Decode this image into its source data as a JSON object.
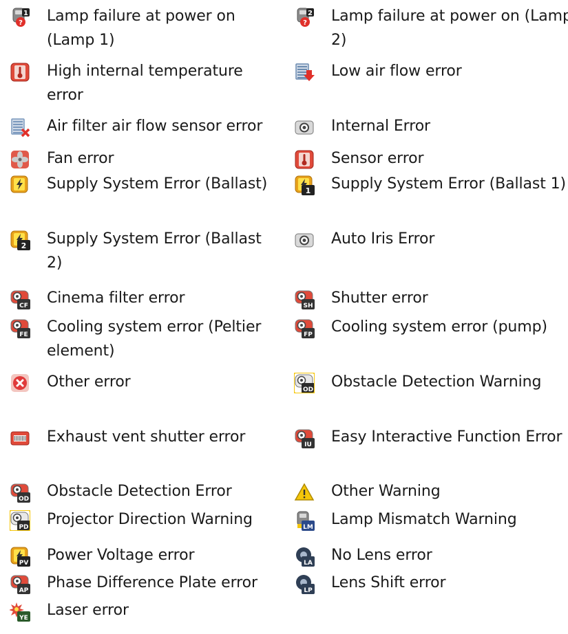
{
  "items": [
    {
      "label": "Lamp failure at power on (Lamp 1)",
      "icon": "lamp-1-failure-icon",
      "badge": "1",
      "style": "lamp",
      "colors": [
        "#8a8a8a",
        "#e0302a"
      ]
    },
    {
      "label": "Lamp failure at power on (Lamp 2)",
      "icon": "lamp-2-failure-icon",
      "badge": "2",
      "style": "lamp",
      "colors": [
        "#8a8a8a",
        "#e0302a"
      ]
    },
    {
      "label": "High internal temperature error",
      "icon": "thermometer-icon",
      "badge": "",
      "style": "temp",
      "colors": [
        "#e04a3a",
        "#ffffff"
      ]
    },
    {
      "label": "Low air flow error",
      "icon": "air-flow-down-icon",
      "badge": "",
      "style": "airflow",
      "colors": [
        "#6b8bb0",
        "#e0302a"
      ]
    },
    {
      "label": "Air filter air flow sensor error",
      "icon": "air-filter-sensor-icon",
      "badge": "",
      "style": "airfilter",
      "colors": [
        "#7a98bd",
        "#e0302a"
      ]
    },
    {
      "label": "Internal Error",
      "icon": "internal-error-icon",
      "badge": "",
      "style": "internal",
      "colors": [
        "#d9d9d9",
        "#444444"
      ]
    },
    {
      "label": "Fan error",
      "icon": "fan-icon",
      "badge": "",
      "style": "fan",
      "colors": [
        "#e05a4a",
        "#cccccc"
      ]
    },
    {
      "label": "Sensor error",
      "icon": "sensor-icon",
      "badge": "",
      "style": "sensor",
      "colors": [
        "#e04a3a",
        "#ffffff"
      ]
    },
    {
      "label": "Supply System Error (Ballast)",
      "icon": "lightning-icon",
      "badge": "",
      "style": "bolt",
      "colors": [
        "#e8a21a",
        "#ffe14a"
      ]
    },
    {
      "label": "Supply System Error (Ballast 1)",
      "icon": "lightning-ballast-1-icon",
      "badge": "1",
      "style": "bolt",
      "colors": [
        "#e8a21a",
        "#ffe14a"
      ]
    },
    {
      "label": "Supply System Error (Ballast 2)",
      "icon": "lightning-ballast-2-icon",
      "badge": "2",
      "style": "bolt",
      "colors": [
        "#e8a21a",
        "#ffe14a"
      ]
    },
    {
      "label": "Auto Iris Error",
      "icon": "auto-iris-icon",
      "badge": "",
      "style": "internal",
      "colors": [
        "#d9d9d9",
        "#444444"
      ]
    },
    {
      "label": "Cinema filter error",
      "icon": "cinema-filter-icon",
      "badge": "CF",
      "style": "projector",
      "colors": [
        "#e04a3a",
        "#ffffff"
      ]
    },
    {
      "label": "Shutter error",
      "icon": "shutter-icon",
      "badge": "SH",
      "style": "projector",
      "colors": [
        "#e04a3a",
        "#ffffff"
      ]
    },
    {
      "label": "Cooling system error (Peltier element)",
      "icon": "cooling-peltier-icon",
      "badge": "FE",
      "style": "projector",
      "colors": [
        "#e04a3a",
        "#ffffff"
      ]
    },
    {
      "label": "Cooling system error (pump)",
      "icon": "cooling-pump-icon",
      "badge": "FP",
      "style": "projector",
      "colors": [
        "#e04a3a",
        "#ffffff"
      ]
    },
    {
      "label": "Other error",
      "icon": "other-error-icon",
      "badge": "",
      "style": "xcircle",
      "colors": [
        "#e03a3a",
        "#ffffff"
      ]
    },
    {
      "label": "Obstacle Detection Warning",
      "icon": "obstacle-warning-icon",
      "badge": "OD",
      "style": "projector-yellow",
      "colors": [
        "#f5c60a",
        "#333333"
      ]
    },
    {
      "label": "Exhaust vent shutter error",
      "icon": "exhaust-vent-icon",
      "badge": "",
      "style": "vent",
      "colors": [
        "#e04a3a",
        "#ffffff"
      ]
    },
    {
      "label": "Easy Interactive Function Error",
      "icon": "interactive-function-icon",
      "badge": "IU",
      "style": "projector",
      "colors": [
        "#e04a3a",
        "#ffffff"
      ]
    },
    {
      "label": "Obstacle Detection Error",
      "icon": "obstacle-error-icon",
      "badge": "OD",
      "style": "projector",
      "colors": [
        "#e04a3a",
        "#ffffff"
      ]
    },
    {
      "label": "Other Warning",
      "icon": "warning-triangle-icon",
      "badge": "",
      "style": "warning",
      "colors": [
        "#f5c60a",
        "#333333"
      ]
    },
    {
      "label": "Projector Direction Warning",
      "icon": "projector-direction-icon",
      "badge": "PD",
      "style": "projector-yellow",
      "colors": [
        "#f5c60a",
        "#333333"
      ]
    },
    {
      "label": "Lamp Mismatch Warning",
      "icon": "lamp-mismatch-icon",
      "badge": "LM",
      "style": "lamp-yellow",
      "colors": [
        "#8a8a8a",
        "#f5c60a"
      ]
    },
    {
      "label": "Power Voltage error",
      "icon": "power-voltage-icon",
      "badge": "PV",
      "style": "bolt",
      "colors": [
        "#e8a21a",
        "#ffe14a"
      ]
    },
    {
      "label": "No Lens error",
      "icon": "no-lens-icon",
      "badge": "LA",
      "style": "lens",
      "colors": [
        "#2f3f55",
        "#ffffff"
      ]
    },
    {
      "label": "Phase Difference Plate error",
      "icon": "phase-plate-icon",
      "badge": "AP",
      "style": "projector",
      "colors": [
        "#e04a3a",
        "#ffffff"
      ]
    },
    {
      "label": "Lens Shift error",
      "icon": "lens-shift-icon",
      "badge": "LP",
      "style": "lens",
      "colors": [
        "#2f3f55",
        "#ffffff"
      ]
    },
    {
      "label": "Laser error",
      "icon": "laser-icon",
      "badge": "YE",
      "style": "laser",
      "colors": [
        "#e04a3a",
        "#ffe14a"
      ]
    }
  ]
}
